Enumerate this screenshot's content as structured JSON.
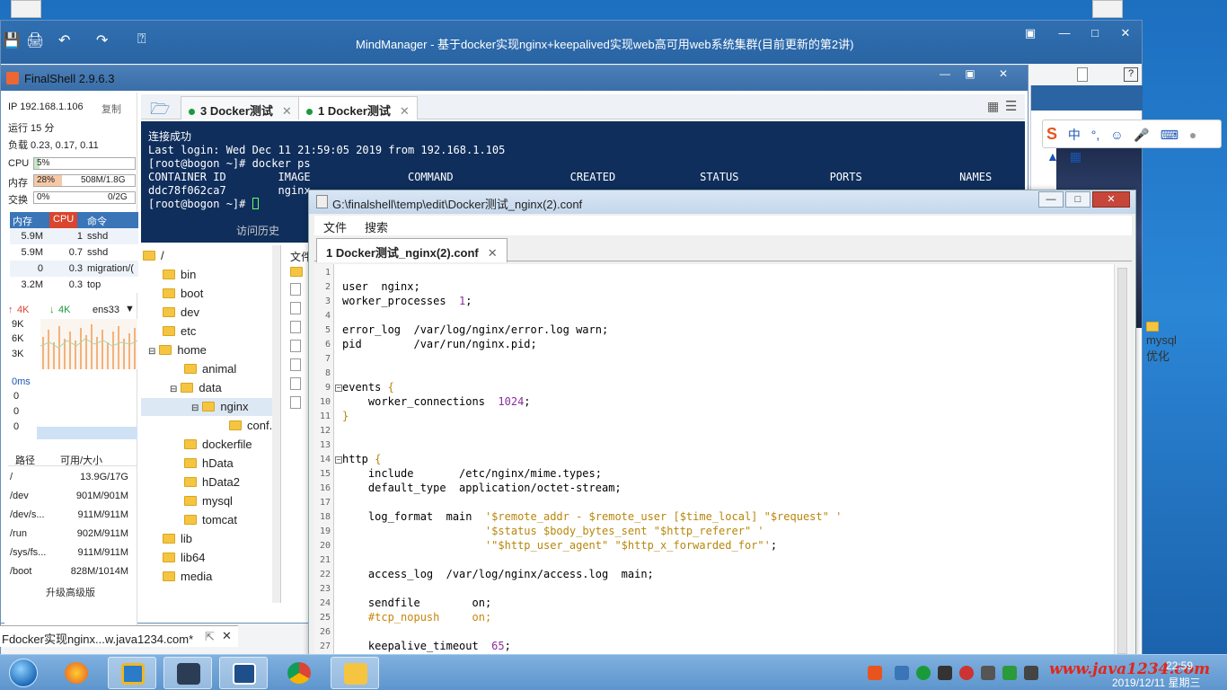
{
  "mindmanager": {
    "title": "MindManager - 基于docker实现nginx+keepalived实现web高可用web系统集群(目前更新的第2讲)",
    "doc_tab": "Fdocker实现nginx...w.java1234.com*",
    "side_item": "mysql优化"
  },
  "finalshell": {
    "title": "FinalShell 2.9.6.3",
    "side": {
      "ip": "IP 192.168.1.106",
      "copy": "复制",
      "uptime": "运行 15 分",
      "load": "负载 0.23, 0.17, 0.11",
      "cpu_label": "CPU",
      "cpu_value": "5%",
      "cpu_fraction": 0.05,
      "mem_label": "内存",
      "mem_pct": "28%",
      "mem_value": "508M/1.8G",
      "mem_fraction": 0.28,
      "swap_label": "交换",
      "swap_pct": "0%",
      "swap_value": "0/2G",
      "proc_headers": [
        "内存",
        "CPU",
        "命令"
      ],
      "procs": [
        {
          "mem": "5.9M",
          "cpu": "1",
          "cmd": "sshd"
        },
        {
          "mem": "5.9M",
          "cpu": "0.7",
          "cmd": "sshd"
        },
        {
          "mem": "0",
          "cpu": "0.3",
          "cmd": "migration/("
        },
        {
          "mem": "3.2M",
          "cpu": "0.3",
          "cmd": "top"
        }
      ],
      "net_up": "4K",
      "net_down": "4K",
      "net_iface": "ens33",
      "net_ticks": [
        "9K",
        "6K",
        "3K"
      ],
      "latency_label": "0ms",
      "latency_ticks": [
        "0",
        "0",
        "0"
      ],
      "disk_headers": [
        "路径",
        "可用/大小"
      ],
      "disks": [
        {
          "path": "/",
          "size": "13.9G/17G"
        },
        {
          "path": "/dev",
          "size": "901M/901M"
        },
        {
          "path": "/dev/s...",
          "size": "911M/911M"
        },
        {
          "path": "/run",
          "size": "902M/911M"
        },
        {
          "path": "/sys/fs...",
          "size": "911M/911M"
        },
        {
          "path": "/boot",
          "size": "828M/1014M"
        }
      ],
      "upgrade": "升级高级版"
    },
    "tabs": [
      {
        "label": "3 Docker测试"
      },
      {
        "label": "1 Docker测试"
      }
    ],
    "terminal": [
      "连接成功",
      "Last login: Wed Dec 11 21:59:05 2019 from 192.168.1.105",
      "[root@bogon ~]# docker ps",
      "CONTAINER ID        IMAGE               COMMAND                  CREATED             STATUS              PORTS               NAMES",
      "ddc78f062ca7        nginx",
      "[root@bogon ~]# "
    ],
    "history_btn": "访问历史",
    "tree": [
      {
        "label": "/",
        "depth": 0
      },
      {
        "label": "bin",
        "depth": 1
      },
      {
        "label": "boot",
        "depth": 1
      },
      {
        "label": "dev",
        "depth": 1
      },
      {
        "label": "etc",
        "depth": 1
      },
      {
        "label": "home",
        "depth": 1
      },
      {
        "label": "animal",
        "depth": 2
      },
      {
        "label": "data",
        "depth": 2
      },
      {
        "label": "nginx",
        "depth": 3
      },
      {
        "label": "conf.c",
        "depth": 4
      },
      {
        "label": "dockerfile",
        "depth": 2
      },
      {
        "label": "hData",
        "depth": 2
      },
      {
        "label": "hData2",
        "depth": 2
      },
      {
        "label": "mysql",
        "depth": 2
      },
      {
        "label": "tomcat",
        "depth": 2
      },
      {
        "label": "lib",
        "depth": 1
      },
      {
        "label": "lib64",
        "depth": 1
      },
      {
        "label": "media",
        "depth": 1
      }
    ],
    "files_header": "文件"
  },
  "editor": {
    "title": "G:\\finalshell\\temp\\edit\\Docker测试_nginx(2).conf",
    "menu": [
      "文件",
      "搜索"
    ],
    "tab": "1 Docker测试_nginx(2).conf",
    "lines": [
      "",
      "user  nginx;",
      "worker_processes  1;",
      "",
      "error_log  /var/log/nginx/error.log warn;",
      "pid        /var/run/nginx.pid;",
      "",
      "",
      "events {",
      "    worker_connections  1024;",
      "}",
      "",
      "",
      "http {",
      "    include       /etc/nginx/mime.types;",
      "    default_type  application/octet-stream;",
      "",
      "    log_format  main  '$remote_addr - $remote_user [$time_local] \"$request\" '",
      "                      '$status $body_bytes_sent \"$http_referer\" '",
      "                      '\"$http_user_agent\" \"$http_x_forwarded_for\"';",
      "",
      "    access_log  /var/log/nginx/access.log  main;",
      "",
      "    sendfile        on;",
      "    #tcp_nopush     on;",
      "",
      "    keepalive_timeout  65;"
    ]
  },
  "ime": {
    "label": "中",
    "punct": "°,"
  },
  "taskbar": {
    "watermark": "www.java1234.com",
    "time": "22:59",
    "date": "2019/12/11 星期三"
  },
  "colors": {
    "terminal_bg": "#0f2e5c",
    "tab_active_dot": "#1a9a3a",
    "accent": "#3a75b8"
  }
}
